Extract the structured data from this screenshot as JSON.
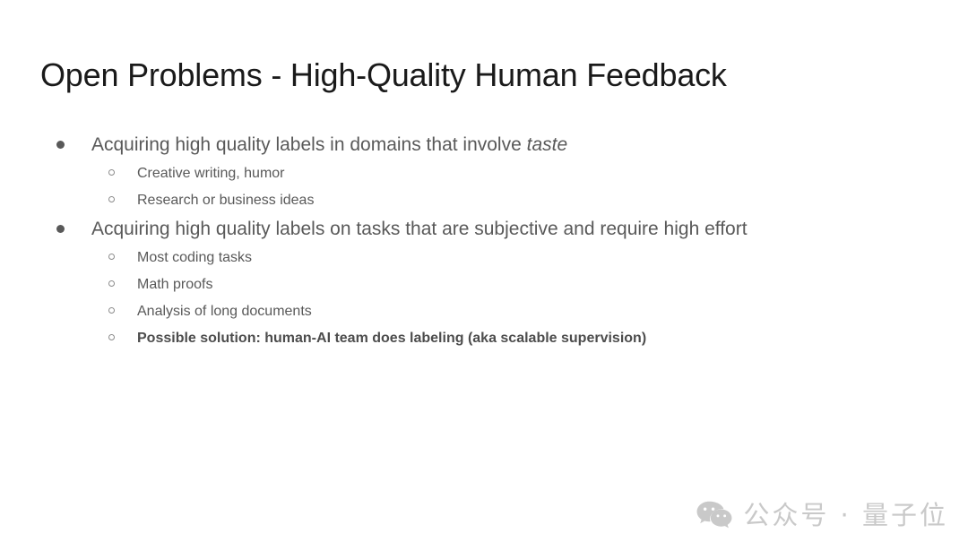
{
  "slide": {
    "title": "Open Problems - High-Quality Human Feedback",
    "bullets": [
      {
        "text_before": "Acquiring high quality labels in domains that involve ",
        "text_italic": "taste",
        "text_after": "",
        "sub": [
          {
            "text": "Creative writing, humor",
            "bold": false
          },
          {
            "text": "Research or business ideas",
            "bold": false
          }
        ]
      },
      {
        "text_before": "Acquiring high quality labels on tasks that are subjective and require high effort",
        "text_italic": "",
        "text_after": "",
        "sub": [
          {
            "text": "Most coding tasks",
            "bold": false
          },
          {
            "text": "Math proofs",
            "bold": false
          },
          {
            "text": "Analysis of long documents",
            "bold": false
          },
          {
            "text": "Possible solution: human-AI team does labeling (aka scalable supervision)",
            "bold": true
          }
        ]
      }
    ]
  },
  "watermark": {
    "icon": "wechat-icon",
    "text": "公众号 · 量子位",
    "color": "#c9c9c9"
  },
  "colors": {
    "background": "#ffffff",
    "title_text": "#1a1a1a",
    "body_text": "#595959",
    "bold_text": "#4d4d4d",
    "sub_marker": "#8c8c8c",
    "watermark": "#c9c9c9"
  }
}
